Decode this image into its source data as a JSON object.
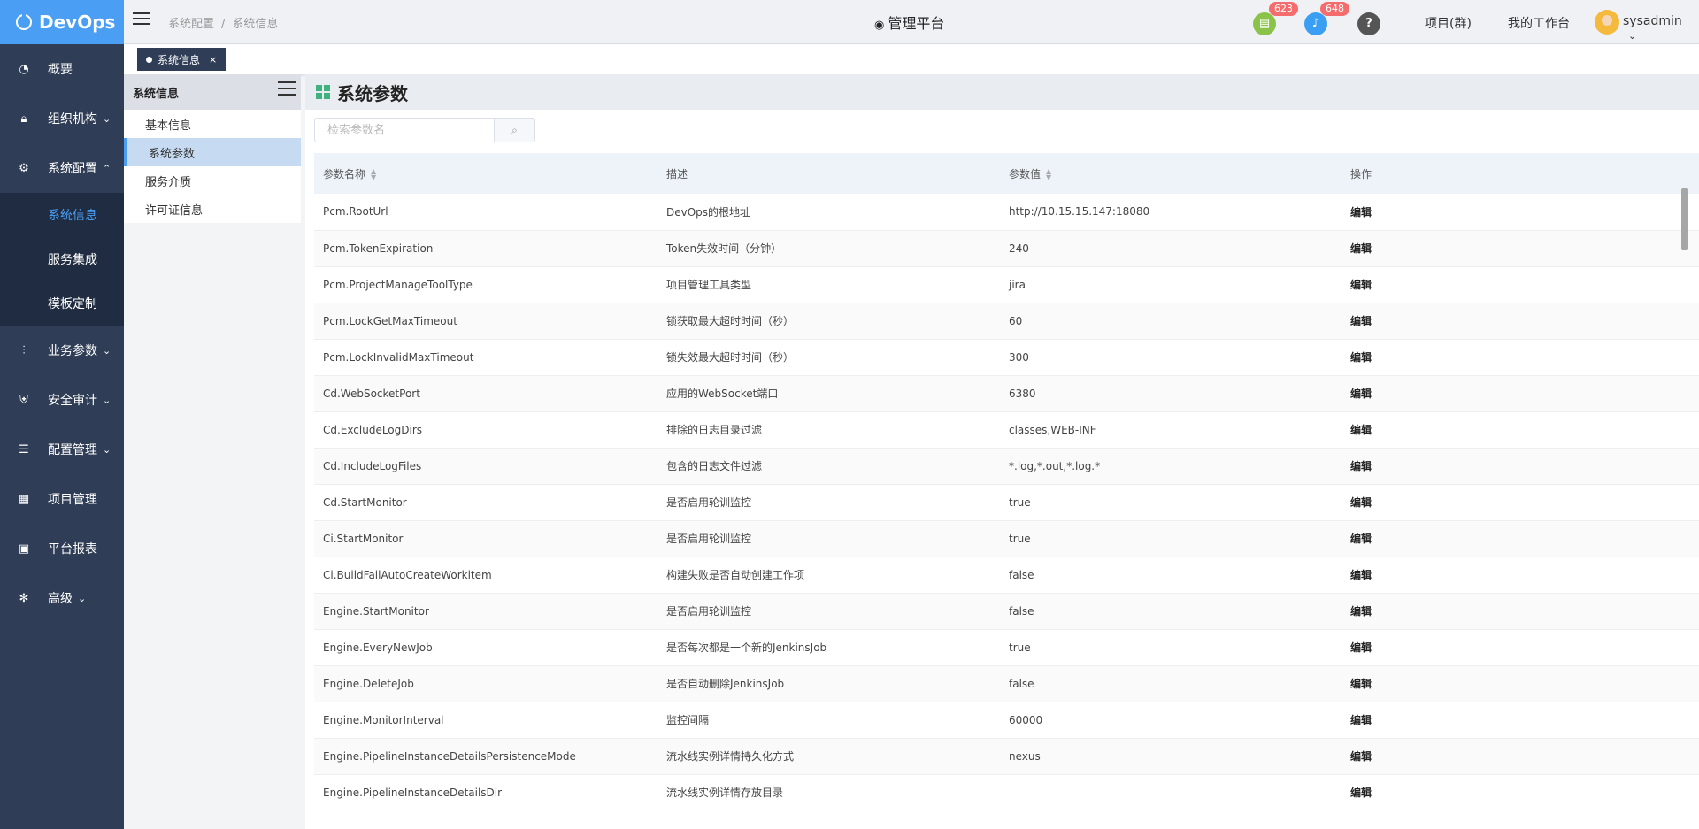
{
  "brand": {
    "name": "DevOps"
  },
  "nav": {
    "items": [
      {
        "label": "概要",
        "icon": "dashboard-icon",
        "chevron": ""
      },
      {
        "label": "组织机构",
        "icon": "lock-icon",
        "chevron": "⌄"
      },
      {
        "label": "系统配置",
        "icon": "gear-icon",
        "chevron": "⌃"
      }
    ],
    "sub_items": [
      {
        "label": "系统信息",
        "active": true
      },
      {
        "label": "服务集成",
        "active": false
      },
      {
        "label": "模板定制",
        "active": false
      }
    ],
    "items_after": [
      {
        "label": "业务参数",
        "icon": "sliders-icon",
        "chevron": "⌄"
      },
      {
        "label": "安全审计",
        "icon": "shield-icon",
        "chevron": "⌄"
      },
      {
        "label": "配置管理",
        "icon": "database-icon",
        "chevron": "⌄"
      },
      {
        "label": "项目管理",
        "icon": "grid-icon",
        "chevron": ""
      },
      {
        "label": "平台报表",
        "icon": "monitor-icon",
        "chevron": ""
      },
      {
        "label": "高级",
        "icon": "advanced-icon",
        "chevron": "⌄"
      }
    ]
  },
  "header": {
    "breadcrumb": [
      "系统配置",
      "系统信息"
    ],
    "platform_title": "管理平台",
    "doc_badge": "623",
    "bell_badge": "648",
    "help_icon": "?",
    "links": {
      "projects": "项目(群)",
      "workbench": "我的工作台"
    },
    "username": "sysadmin"
  },
  "tabs": [
    {
      "label": "系统信息",
      "close": "×"
    }
  ],
  "subpanel": {
    "title": "系统信息",
    "items": [
      "基本信息",
      "系统参数",
      "服务介质",
      "许可证信息"
    ],
    "active_index": 1
  },
  "main": {
    "title": "系统参数",
    "search_placeholder": "检索参数名",
    "columns": [
      "参数名称",
      "描述",
      "参数值",
      "操作"
    ],
    "rows": [
      [
        "Pcm.RootUrl",
        "DevOps的根地址",
        "http://10.15.15.147:18080",
        "编辑"
      ],
      [
        "Pcm.TokenExpiration",
        "Token失效时间（分钟）",
        "240",
        "编辑"
      ],
      [
        "Pcm.ProjectManageToolType",
        "项目管理工具类型",
        "jira",
        "编辑"
      ],
      [
        "Pcm.LockGetMaxTimeout",
        "锁获取最大超时时间（秒）",
        "60",
        "编辑"
      ],
      [
        "Pcm.LockInvalidMaxTimeout",
        "锁失效最大超时时间（秒）",
        "300",
        "编辑"
      ],
      [
        "Cd.WebSocketPort",
        "应用的WebSocket端口",
        "6380",
        "编辑"
      ],
      [
        "Cd.ExcludeLogDirs",
        "排除的日志目录过滤",
        "classes,WEB-INF",
        "编辑"
      ],
      [
        "Cd.IncludeLogFiles",
        "包含的日志文件过滤",
        "*.log,*.out,*.log.*",
        "编辑"
      ],
      [
        "Cd.StartMonitor",
        "是否启用轮训监控",
        "true",
        "编辑"
      ],
      [
        "Ci.StartMonitor",
        "是否启用轮训监控",
        "true",
        "编辑"
      ],
      [
        "Ci.BuildFailAutoCreateWorkitem",
        "构建失败是否自动创建工作项",
        "false",
        "编辑"
      ],
      [
        "Engine.StartMonitor",
        "是否启用轮训监控",
        "false",
        "编辑"
      ],
      [
        "Engine.EveryNewJob",
        "是否每次都是一个新的JenkinsJob",
        "true",
        "编辑"
      ],
      [
        "Engine.DeleteJob",
        "是否自动删除JenkinsJob",
        "false",
        "编辑"
      ],
      [
        "Engine.MonitorInterval",
        "监控间隔",
        "60000",
        "编辑"
      ],
      [
        "Engine.PipelineInstanceDetailsPersistenceMode",
        "流水线实例详情持久化方式",
        "nexus",
        "编辑"
      ],
      [
        "Engine.PipelineInstanceDetailsDir",
        "流水线实例详情存放目录",
        "",
        "编辑"
      ]
    ]
  }
}
